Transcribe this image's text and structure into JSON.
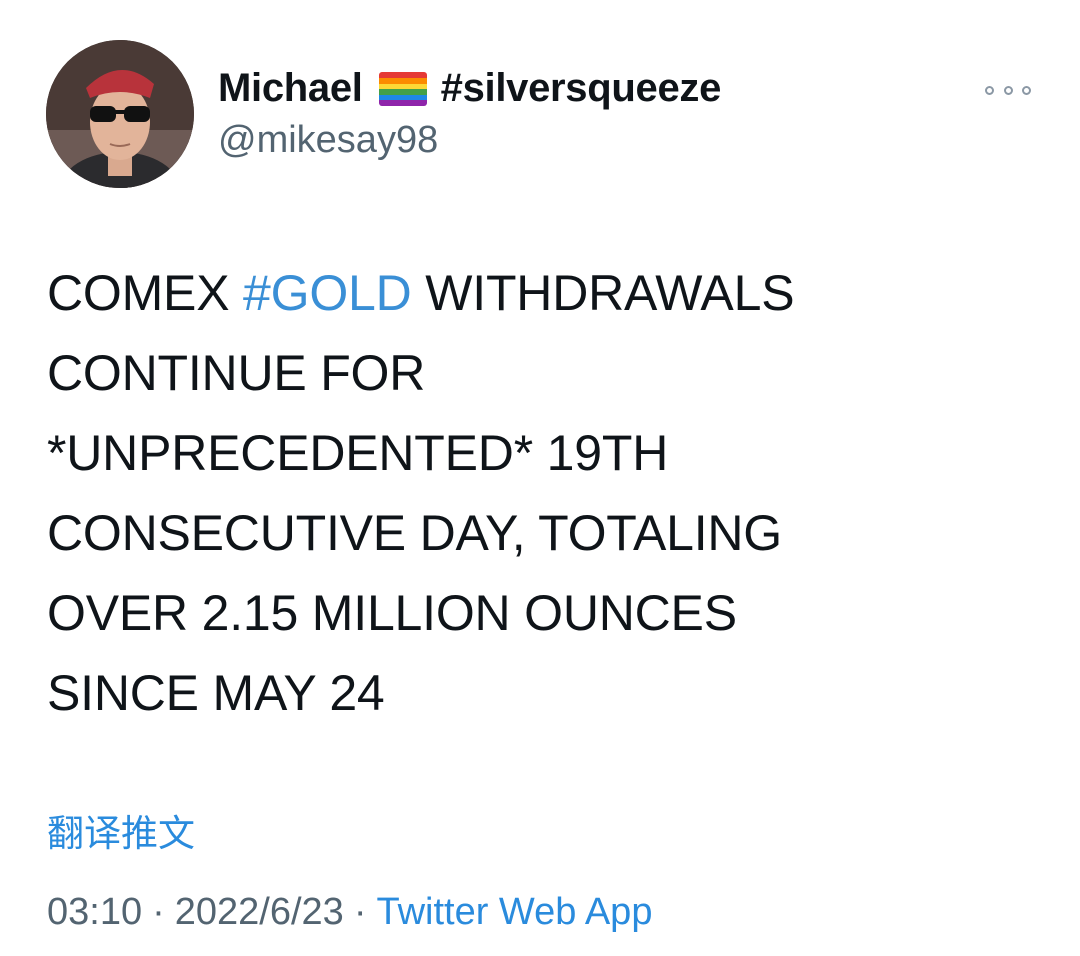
{
  "author": {
    "name": "Michael",
    "flag_icon": "rainbow-flag-icon",
    "name_hashtag": "#silversqueeze",
    "handle": "@mikesay98"
  },
  "tweet": {
    "lines": [
      {
        "before": "COMEX ",
        "hashtag": "#GOLD",
        "after": " WITHDRAWALS"
      },
      {
        "text": "CONTINUE FOR"
      },
      {
        "text": "*UNPRECEDENTED* 19TH"
      },
      {
        "text": "CONSECUTIVE DAY, TOTALING"
      },
      {
        "text": "OVER 2.15 MILLION OUNCES"
      },
      {
        "text": "SINCE MAY 24"
      }
    ]
  },
  "translate_label": "翻译推文",
  "meta": {
    "time": "03:10",
    "separator": "·",
    "date": "2022/6/23",
    "source": "Twitter Web App"
  },
  "colors": {
    "link": "#2a8bdd",
    "secondary_text": "#536471",
    "primary_text": "#0f1419"
  }
}
